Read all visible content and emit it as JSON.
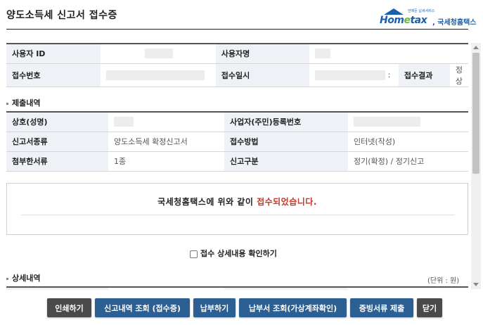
{
  "header": {
    "title": "양도소득세 신고서 접수증",
    "logo": {
      "word_a": "Hom",
      "word_e": "e",
      "word_b": "tax",
      "sub": ", 국세청홈택스",
      "tagline": "언제든 납세서비스"
    }
  },
  "receipt_table": {
    "user_id_label": "사용자 ID",
    "user_name_label": "사용자명",
    "receipt_no_label": "접수번호",
    "receipt_datetime_label": "접수일시",
    "receipt_datetime_tail": ":",
    "receipt_result_label": "접수결과",
    "receipt_result_value": "정상"
  },
  "submission": {
    "section_label": "제출내역",
    "company_label": "상호(성명)",
    "bizno_label": "사업자(주민)등록번호",
    "form_type_label": "신고서종류",
    "form_type_value": "양도소득세 확정신고서",
    "method_label": "접수방법",
    "method_value": "인터넷(작성)",
    "attach_label": "첨부한서류",
    "attach_value": "1종",
    "category_label": "신고구분",
    "category_value": "정기(확정) / 정기신고"
  },
  "notice": {
    "text_prefix": "국세청홈택스에 위와 같이 ",
    "text_highlight": "접수되었습니다.",
    "highlight_color": "#c0392b"
  },
  "confirm": {
    "label": "접수 상세내용 확인하기",
    "checked": false
  },
  "detail": {
    "section_label": "상세내역",
    "unit": "(단위 : 원)"
  },
  "buttons": {
    "print": "인쇄하기",
    "history": "신고내역 조회 (접수증)",
    "pay": "납부하기",
    "bill": "납부서 조회(가상계좌확인)",
    "certificate": "증빙서류 제출",
    "close": "닫기"
  },
  "colors": {
    "primary_button": "#2c5f93",
    "dark_button": "#4a4a4a",
    "header_cell": "#eef2f7",
    "logo_blue": "#1b5faa",
    "logo_green": "#6db33f"
  }
}
